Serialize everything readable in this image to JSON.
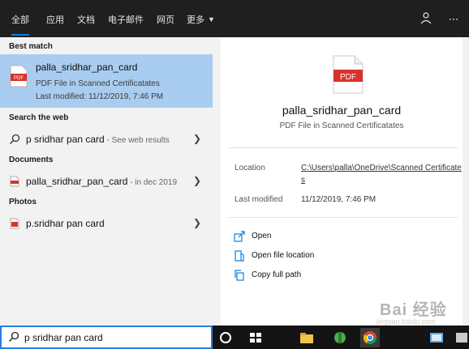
{
  "tabs": [
    {
      "label": "全部"
    },
    {
      "label": "应用"
    },
    {
      "label": "文档"
    },
    {
      "label": "电子邮件"
    },
    {
      "label": "网页"
    },
    {
      "label": "更多"
    }
  ],
  "top_icons": [
    "feedback-icon",
    "more-icon"
  ],
  "results": {
    "best_match_label": "Best match",
    "best_match": {
      "title": "palla_sridhar_pan_card",
      "subtitle": "PDF File in Scanned Certificatates",
      "modified": "Last modified: 11/12/2019, 7:46 PM"
    },
    "web_label": "Search the web",
    "web_item": {
      "text": "p sridhar pan card",
      "hint": " - See web results"
    },
    "documents_label": "Documents",
    "document_item": {
      "text": "palla_sridhar_pan_card",
      "hint": " - in dec 2019"
    },
    "photos_label": "Photos",
    "photo_item": {
      "text": "p.sridhar pan card"
    }
  },
  "preview": {
    "icon_text": "PDF",
    "title": "palla_sridhar_pan_card",
    "subtitle": "PDF File in Scanned Certificatates",
    "location_label": "Location",
    "location_value": "C:\\Users\\palla\\OneDrive\\Scanned Certificates",
    "modified_label": "Last modified",
    "modified_value": "11/12/2019, 7:46 PM",
    "actions": [
      "Open",
      "Open file location",
      "Copy full path"
    ]
  },
  "taskbar": {
    "search_value": "p sridhar pan card",
    "watermark": "jingyan.baidu.com"
  },
  "colors": {
    "accent": "#0a7ee0",
    "selection": "#a9cdf0",
    "pdf_red": "#d6342b"
  }
}
